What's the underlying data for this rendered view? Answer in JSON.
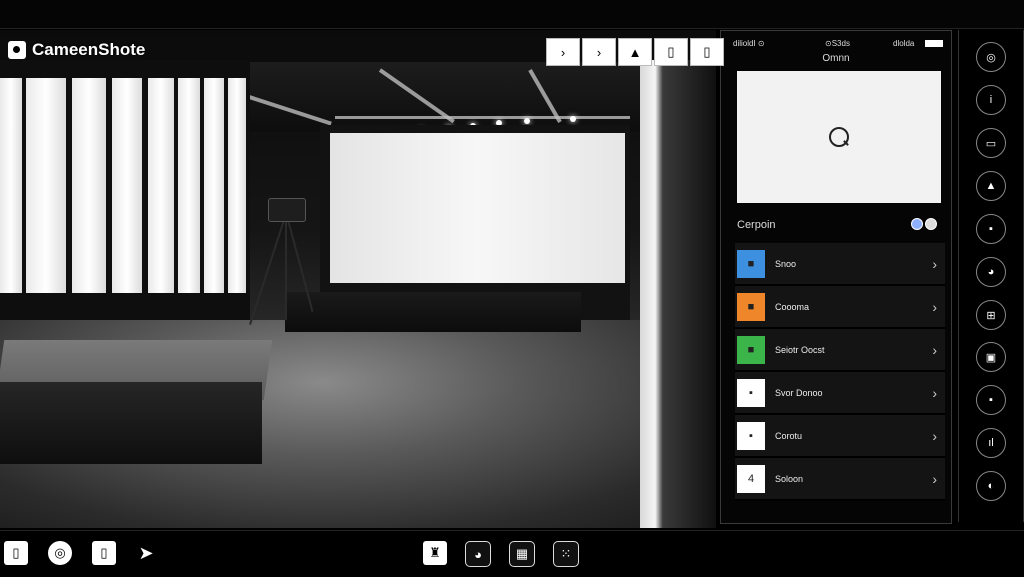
{
  "app": {
    "title": "CameenShote"
  },
  "toolbar": {
    "buttons": [
      {
        "name": "chevron-icon",
        "glyph": "›"
      },
      {
        "name": "chevron-icon",
        "glyph": "›"
      },
      {
        "name": "triangle-icon",
        "glyph": "▲"
      },
      {
        "name": "frame-icon",
        "glyph": "▯"
      },
      {
        "name": "frame-icon",
        "glyph": "▯"
      }
    ]
  },
  "panel": {
    "status_left": "dilioldI ⊙",
    "status_mid": "⊙S3ds",
    "status_right": "dlolda",
    "title": "Omnn",
    "category_label": "Cerpoin",
    "items": [
      {
        "label": "Snoo",
        "thumb_color": "#3d8fe0",
        "thumb_glyph": "■"
      },
      {
        "label": "Coooma",
        "thumb_color": "#f0862a",
        "thumb_glyph": "■"
      },
      {
        "label": "Seiotr Oocst",
        "thumb_color": "#3bb54a",
        "thumb_glyph": "■"
      },
      {
        "label": "Svor Donoo",
        "thumb_color": "#ffffff",
        "thumb_glyph": "▪"
      },
      {
        "label": "Corotu",
        "thumb_color": "#ffffff",
        "thumb_glyph": "▪"
      },
      {
        "label": "Soloon",
        "thumb_color": "#ffffff",
        "thumb_glyph": "4"
      }
    ]
  },
  "rail": {
    "buttons": [
      {
        "name": "spiral-icon",
        "glyph": "◎"
      },
      {
        "name": "info-icon",
        "glyph": "i"
      },
      {
        "name": "monitor-icon",
        "glyph": "▭"
      },
      {
        "name": "user-icon",
        "glyph": "▲"
      },
      {
        "name": "document-icon",
        "glyph": "▪"
      },
      {
        "name": "face-icon",
        "glyph": "◕"
      },
      {
        "name": "grid-icon",
        "glyph": "⊞"
      },
      {
        "name": "camera-icon",
        "glyph": "▣"
      },
      {
        "name": "lock-icon",
        "glyph": "▪"
      },
      {
        "name": "chart-icon",
        "glyph": "ıl"
      },
      {
        "name": "pin-icon",
        "glyph": "◐"
      }
    ]
  },
  "bottombar": {
    "left": [
      {
        "name": "phone-icon",
        "glyph": "▯"
      },
      {
        "name": "refresh-icon",
        "glyph": "◎"
      },
      {
        "name": "file-icon",
        "glyph": "▯"
      },
      {
        "name": "send-icon",
        "glyph": "➤"
      }
    ],
    "center": [
      {
        "name": "figure-icon",
        "glyph": "♜"
      },
      {
        "name": "gamepad-icon",
        "glyph": "◕"
      },
      {
        "name": "grid-icon",
        "glyph": "▦"
      },
      {
        "name": "dice-icon",
        "glyph": "⁙"
      }
    ]
  }
}
